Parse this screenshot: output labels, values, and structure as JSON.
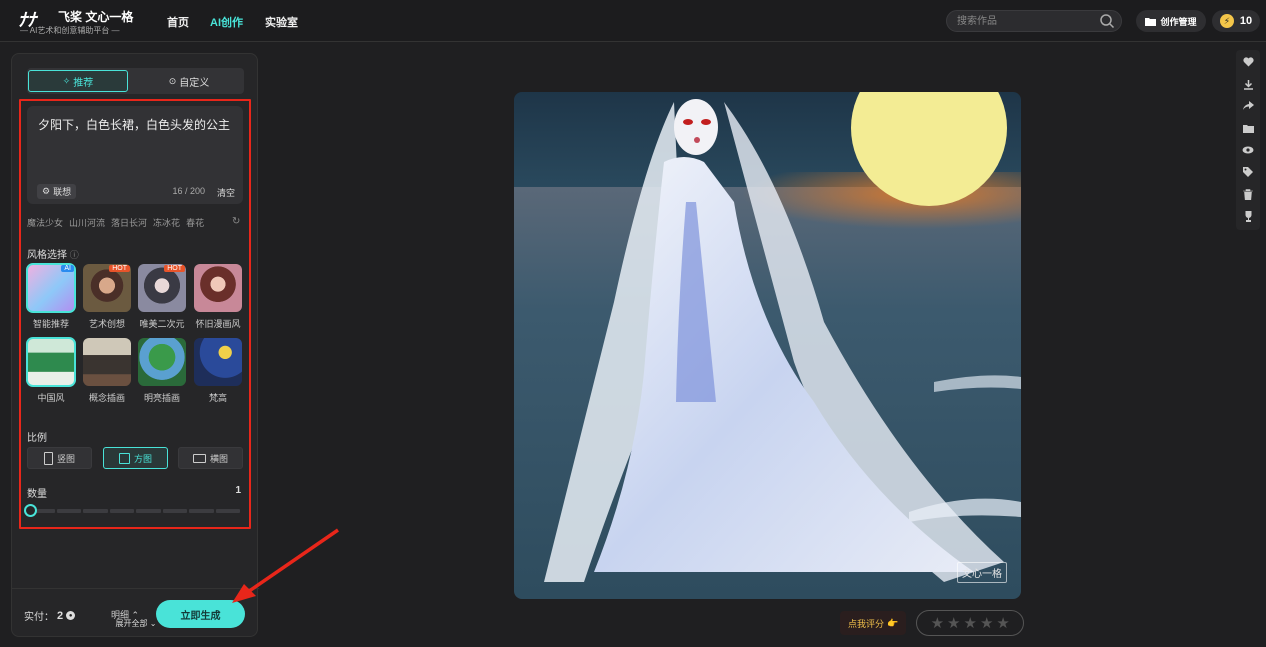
{
  "header": {
    "logo_mark": "ﾅﾅ",
    "logo_title": "飞桨 文心一格",
    "logo_subtitle": "— AI艺术和创意辅助平台 —",
    "nav": [
      {
        "label": "首页"
      },
      {
        "label": "AI创作"
      },
      {
        "label": "实验室"
      }
    ],
    "search_placeholder": "搜索作品",
    "manage_label": "创作管理",
    "credits": "10"
  },
  "panel": {
    "tabs": [
      {
        "label": "推荐"
      },
      {
        "label": "自定义"
      }
    ],
    "prompt": "夕阳下，白色长裙，白色头发的公主",
    "assoc_label": "联想",
    "counter": "16 / 200",
    "clear_label": "清空",
    "suggestions": [
      "魔法少女",
      "山川河流",
      "落日长河",
      "冻冰花",
      "春花"
    ],
    "style_title": "风格选择",
    "styles": [
      {
        "name": "智能推荐",
        "badge": "AI"
      },
      {
        "name": "艺术创想",
        "badge": "HOT"
      },
      {
        "name": "唯美二次元",
        "badge": "HOT"
      },
      {
        "name": "怀旧漫画风",
        "badge": ""
      },
      {
        "name": "中国风",
        "badge": ""
      },
      {
        "name": "概念插画",
        "badge": ""
      },
      {
        "name": "明亮插画",
        "badge": ""
      },
      {
        "name": "梵高",
        "badge": ""
      }
    ],
    "expand_label": "展开全部",
    "ratio_title": "比例",
    "ratios": [
      {
        "label": "竖图"
      },
      {
        "label": "方图"
      },
      {
        "label": "横图"
      }
    ],
    "quantity_title": "数量",
    "quantity_value": "1",
    "cost_label": "实付：",
    "cost_value": "2",
    "detail_label": "明细",
    "generate_label": "立即生成"
  },
  "canvas": {
    "watermark": "文心一格"
  },
  "rating": {
    "label": "点我评分",
    "stars": [
      "★",
      "★",
      "★",
      "★",
      "★"
    ]
  },
  "colors": {
    "accent": "#49e3d8",
    "annotation": "#e8261a"
  }
}
